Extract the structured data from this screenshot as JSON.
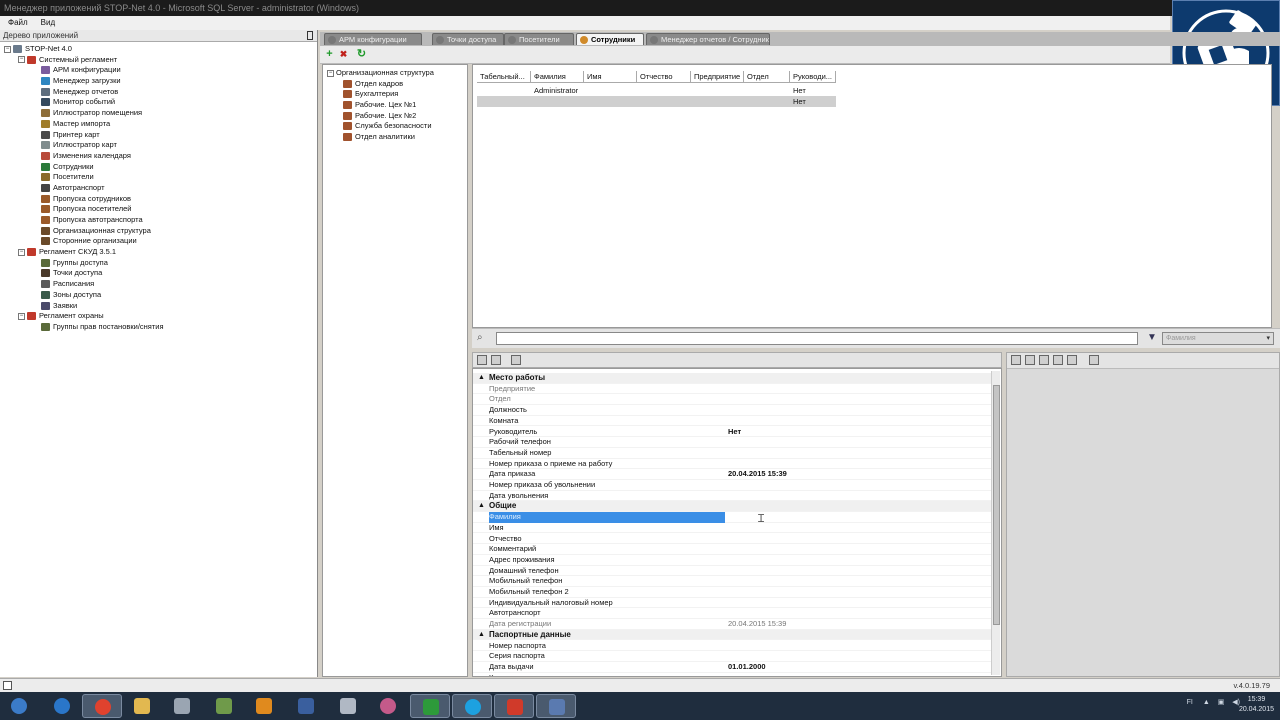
{
  "window": {
    "title": "Менеджер приложений STOP-Net 4.0 - Microsoft SQL Server - administrator (Windows)"
  },
  "menu": {
    "file": "Файл",
    "view": "Вид"
  },
  "left_panel": {
    "header": "Дерево приложений",
    "tree": [
      {
        "label": "STOP-Net 4.0",
        "level": 0,
        "expander": "−",
        "icon": "computer-icon"
      },
      {
        "label": "Системный регламент",
        "level": 1,
        "expander": "−",
        "icon": "shield-icon"
      },
      {
        "label": "АРМ конфигурации",
        "level": 2,
        "icon": "workstation-icon"
      },
      {
        "label": "Менеджер загрузки",
        "level": 2,
        "icon": "download-icon"
      },
      {
        "label": "Менеджер отчетов",
        "level": 2,
        "icon": "report-icon"
      },
      {
        "label": "Монитор событий",
        "level": 2,
        "icon": "monitor-icon"
      },
      {
        "label": "Иллюстратор помещения",
        "level": 2,
        "icon": "room-icon"
      },
      {
        "label": "Мастер импорта",
        "level": 2,
        "icon": "import-icon"
      },
      {
        "label": "Принтер карт",
        "level": 2,
        "icon": "printer-icon"
      },
      {
        "label": "Иллюстратор карт",
        "level": 2,
        "icon": "card-icon"
      },
      {
        "label": "Изменения календаря",
        "level": 2,
        "icon": "calendar-icon"
      },
      {
        "label": "Сотрудники",
        "level": 2,
        "icon": "employees-icon"
      },
      {
        "label": "Посетители",
        "level": 2,
        "icon": "visitors-icon"
      },
      {
        "label": "Автотранспорт",
        "level": 2,
        "icon": "car-icon"
      },
      {
        "label": "Пропуска сотрудников",
        "level": 2,
        "icon": "pass-icon"
      },
      {
        "label": "Пропуска посетителей",
        "level": 2,
        "icon": "pass-icon"
      },
      {
        "label": "Пропуска автотранспорта",
        "level": 2,
        "icon": "pass-icon"
      },
      {
        "label": "Организационная структура",
        "level": 2,
        "icon": "org-icon"
      },
      {
        "label": "Сторонние организации",
        "level": 2,
        "icon": "org-icon"
      },
      {
        "label": "Регламент СКУД 3.5.1",
        "level": 1,
        "expander": "−",
        "icon": "shield-icon"
      },
      {
        "label": "Группы доступа",
        "level": 2,
        "icon": "group-icon"
      },
      {
        "label": "Точки доступа",
        "level": 2,
        "icon": "door-icon"
      },
      {
        "label": "Расписания",
        "level": 2,
        "icon": "clock-icon"
      },
      {
        "label": "Зоны доступа",
        "level": 2,
        "icon": "zone-icon"
      },
      {
        "label": "Заявки",
        "level": 2,
        "icon": "request-icon"
      },
      {
        "label": "Регламент охраны",
        "level": 1,
        "expander": "−",
        "icon": "shield-icon"
      },
      {
        "label": "Группы прав постановки/снятия",
        "level": 2,
        "icon": "group-icon"
      }
    ]
  },
  "tabs": [
    {
      "label": "АРМ конфигурации",
      "active": false
    },
    {
      "label": "Точки доступа",
      "active": false
    },
    {
      "label": "Посетители",
      "active": false
    },
    {
      "label": "Сотрудники",
      "active": true
    },
    {
      "label": "Менеджер отчетов / Сотрудники",
      "active": false
    }
  ],
  "toolbar": {
    "add": "+",
    "delete": "✖",
    "refresh": "↻"
  },
  "org_tree": [
    {
      "label": "Организационная структура",
      "level": 0,
      "expander": "−"
    },
    {
      "label": "Отдел кадров",
      "level": 1
    },
    {
      "label": "Бухгалтерия",
      "level": 1
    },
    {
      "label": "Рабочие. Цех №1",
      "level": 1
    },
    {
      "label": "Рабочие. Цех №2",
      "level": 1
    },
    {
      "label": "Служба безопасности",
      "level": 1
    },
    {
      "label": "Отдел аналитики",
      "level": 1
    }
  ],
  "grid": {
    "columns": [
      "Табельный...",
      "Фамилия",
      "Имя",
      "Отчество",
      "Предприятие",
      "Отдел",
      "Руководи..."
    ],
    "rows": [
      [
        "",
        "Administrator",
        "",
        "",
        "",
        "",
        "Нет"
      ],
      [
        "",
        "",
        "",
        "",
        "",
        "",
        "Нет"
      ]
    ]
  },
  "search": {
    "value": "",
    "filter": "Фамилия"
  },
  "properties": [
    {
      "type": "cat",
      "label": "Место работы"
    },
    {
      "label": "Предприятие",
      "value": "",
      "muted": true
    },
    {
      "label": "Отдел",
      "value": "",
      "muted": true
    },
    {
      "label": "Должность",
      "value": ""
    },
    {
      "label": "Комната",
      "value": ""
    },
    {
      "label": "Руководитель",
      "value": "Нет"
    },
    {
      "label": "Рабочий телефон",
      "value": ""
    },
    {
      "label": "Табельный номер",
      "value": ""
    },
    {
      "label": "Номер приказа о приеме на работу",
      "value": ""
    },
    {
      "label": "Дата приказа",
      "value": "20.04.2015 15:39"
    },
    {
      "label": "Номер приказа об увольнении",
      "value": ""
    },
    {
      "label": "Дата увольнения",
      "value": ""
    },
    {
      "type": "cat",
      "label": "Общие"
    },
    {
      "label": "Фамилия",
      "value": "",
      "selected": true
    },
    {
      "label": "Имя",
      "value": ""
    },
    {
      "label": "Отчество",
      "value": ""
    },
    {
      "label": "Комментарий",
      "value": ""
    },
    {
      "label": "Адрес проживания",
      "value": ""
    },
    {
      "label": "Домашний телефон",
      "value": ""
    },
    {
      "label": "Мобильный телефон",
      "value": ""
    },
    {
      "label": "Мобильный телефон 2",
      "value": ""
    },
    {
      "label": "Индивидуальный налоговый номер",
      "value": ""
    },
    {
      "label": "Автотранспорт",
      "value": ""
    },
    {
      "label": "Дата регистрации",
      "value": "20.04.2015 15:39",
      "muted": true
    },
    {
      "type": "cat",
      "label": "Паспортные данные"
    },
    {
      "label": "Номер паспорта",
      "value": ""
    },
    {
      "label": "Серия паспорта",
      "value": ""
    },
    {
      "label": "Дата выдачи",
      "value": "01.01.2000"
    },
    {
      "label": "Кем выдан",
      "value": ""
    }
  ],
  "status": {
    "version": "v.4.0.19.79"
  },
  "taskbar": {
    "lang": "FI",
    "time": "15:39",
    "date": "20.04.2015"
  },
  "colors": {
    "selection": "#3a8ee6",
    "taskbar": "#1f2d3e",
    "logo_bg": "#0d3a6e"
  }
}
